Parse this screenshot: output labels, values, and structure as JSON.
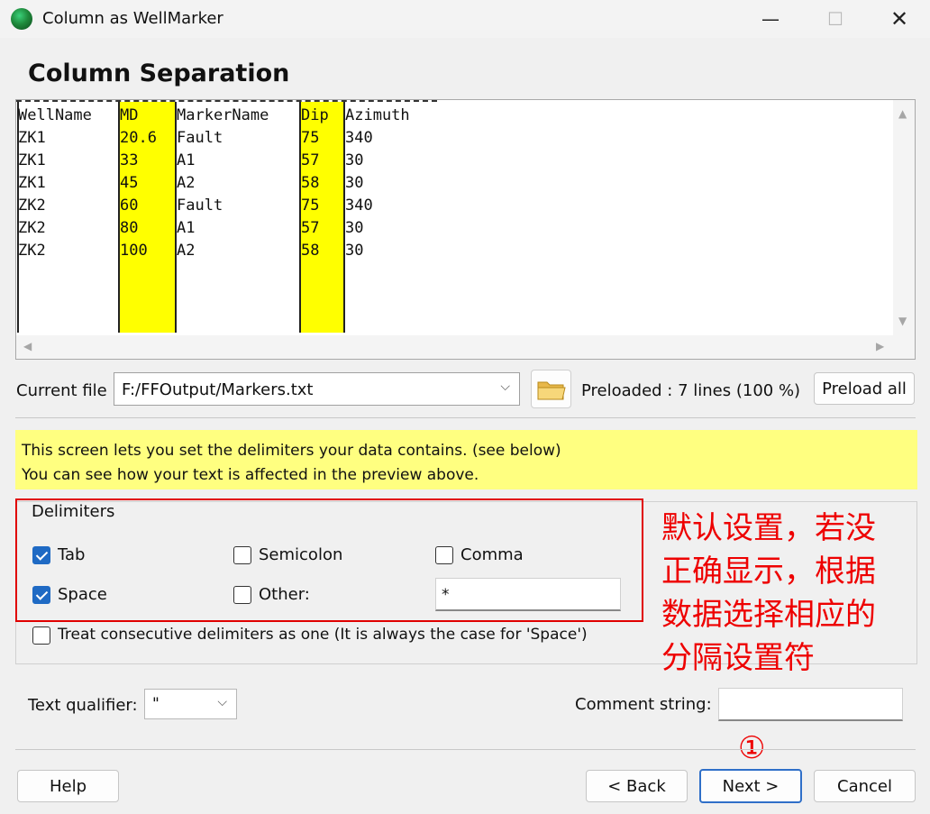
{
  "window": {
    "title": "Column as WellMarker"
  },
  "page": {
    "heading": "Column Separation"
  },
  "preview": {
    "header": [
      "WellName",
      "MD",
      "MarkerName",
      "Dip",
      "Azimuth"
    ],
    "rows": [
      [
        "ZK1",
        "20.6",
        "Fault",
        "75",
        "340"
      ],
      [
        "ZK1",
        "33",
        "A1",
        "57",
        "30"
      ],
      [
        "ZK1",
        "45",
        "A2",
        "58",
        "30"
      ],
      [
        "ZK2",
        "60",
        "Fault",
        "75",
        "340"
      ],
      [
        "ZK2",
        "80",
        "A1",
        "57",
        "30"
      ],
      [
        "ZK2",
        "100",
        "A2",
        "58",
        "30"
      ]
    ],
    "highlight_color": "#ffff00"
  },
  "file": {
    "label": "Current file",
    "path": "F:/FFOutput/Markers.txt",
    "preloaded": "Preloaded : 7 lines (100 %)",
    "preload_all": "Preload all"
  },
  "info": {
    "line1": "This screen lets you set the delimiters your data contains. (see below)",
    "line2": "You can see how your text is affected in the preview above."
  },
  "delimiters": {
    "title": "Delimiters",
    "tab": "Tab",
    "tab_checked": true,
    "semicolon": "Semicolon",
    "semicolon_checked": false,
    "comma": "Comma",
    "comma_checked": false,
    "space": "Space",
    "space_checked": true,
    "other": "Other:",
    "other_checked": false,
    "other_value": "*",
    "consecutive": "Treat consecutive delimiters as one (It is always the case for 'Space')",
    "consecutive_checked": false
  },
  "annotation": {
    "lines": [
      "默认设置，若没",
      "正确显示，根据",
      "数据选择相应的",
      "分隔设置符"
    ],
    "marker": "①",
    "color": "#ee0000"
  },
  "options": {
    "qualifier_label": "Text qualifier:",
    "qualifier_value": "\"",
    "comment_label": "Comment string:",
    "comment_value": ""
  },
  "buttons": {
    "help": "Help",
    "back": "< Back",
    "next": "Next >",
    "cancel": "Cancel"
  }
}
